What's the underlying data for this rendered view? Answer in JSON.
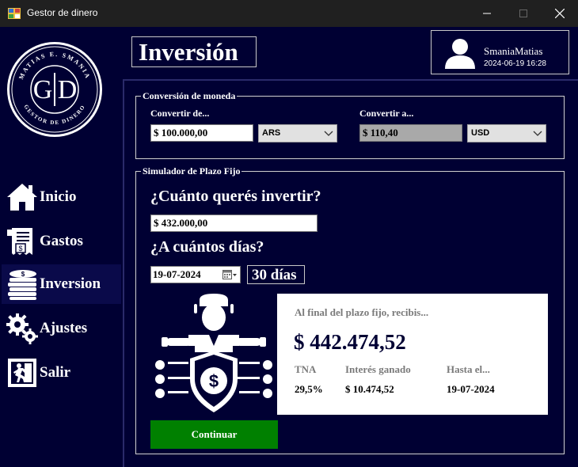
{
  "window": {
    "title": "Gestor de dinero"
  },
  "logo": {
    "top_text": "MATIAS E. SMANIA",
    "bottom_text": "GESTOR DE DINERO",
    "left_letter": "G",
    "right_letter": "D"
  },
  "sidebar": {
    "items": [
      {
        "label": "Inicio",
        "icon": "home-icon",
        "active": false
      },
      {
        "label": "Gastos",
        "icon": "receipt-icon",
        "active": false
      },
      {
        "label": "Inversion",
        "icon": "coins-icon",
        "active": true
      },
      {
        "label": "Ajustes",
        "icon": "gears-icon",
        "active": false
      },
      {
        "label": "Salir",
        "icon": "exit-icon",
        "active": false
      }
    ]
  },
  "header": {
    "page_title": "Inversión",
    "user_name": "SmaniaMatias",
    "user_datetime": "2024-06-19 16:28"
  },
  "conversion": {
    "group_title": "Conversión de moneda",
    "from_label": "Convertir de...",
    "from_value": "$ 100.000,00",
    "from_currency": "ARS",
    "to_label": "Convertir a...",
    "to_value": "$ 110,40",
    "to_currency": "USD"
  },
  "simulator": {
    "group_title": "Simulador de Plazo Fijo",
    "amount_question": "¿Cuánto querés invertir?",
    "amount_value": "$ 432.000,00",
    "days_question": "¿A cuántos días?",
    "date_value": "19-07-2024",
    "days_display": "30 días",
    "result_caption": "Al final del plazo fijo, recibis...",
    "result_amount": "$ 442.474,52",
    "stats": [
      {
        "label": "TNA",
        "value": "29,5%"
      },
      {
        "label": "Interés ganado",
        "value": "$ 10.474,52"
      },
      {
        "label": "Hasta el...",
        "value": "19-07-2024"
      }
    ],
    "continue_label": "Continuar"
  },
  "colors": {
    "background": "#000033",
    "continue_button": "#008000",
    "title_bar": "#202020"
  }
}
